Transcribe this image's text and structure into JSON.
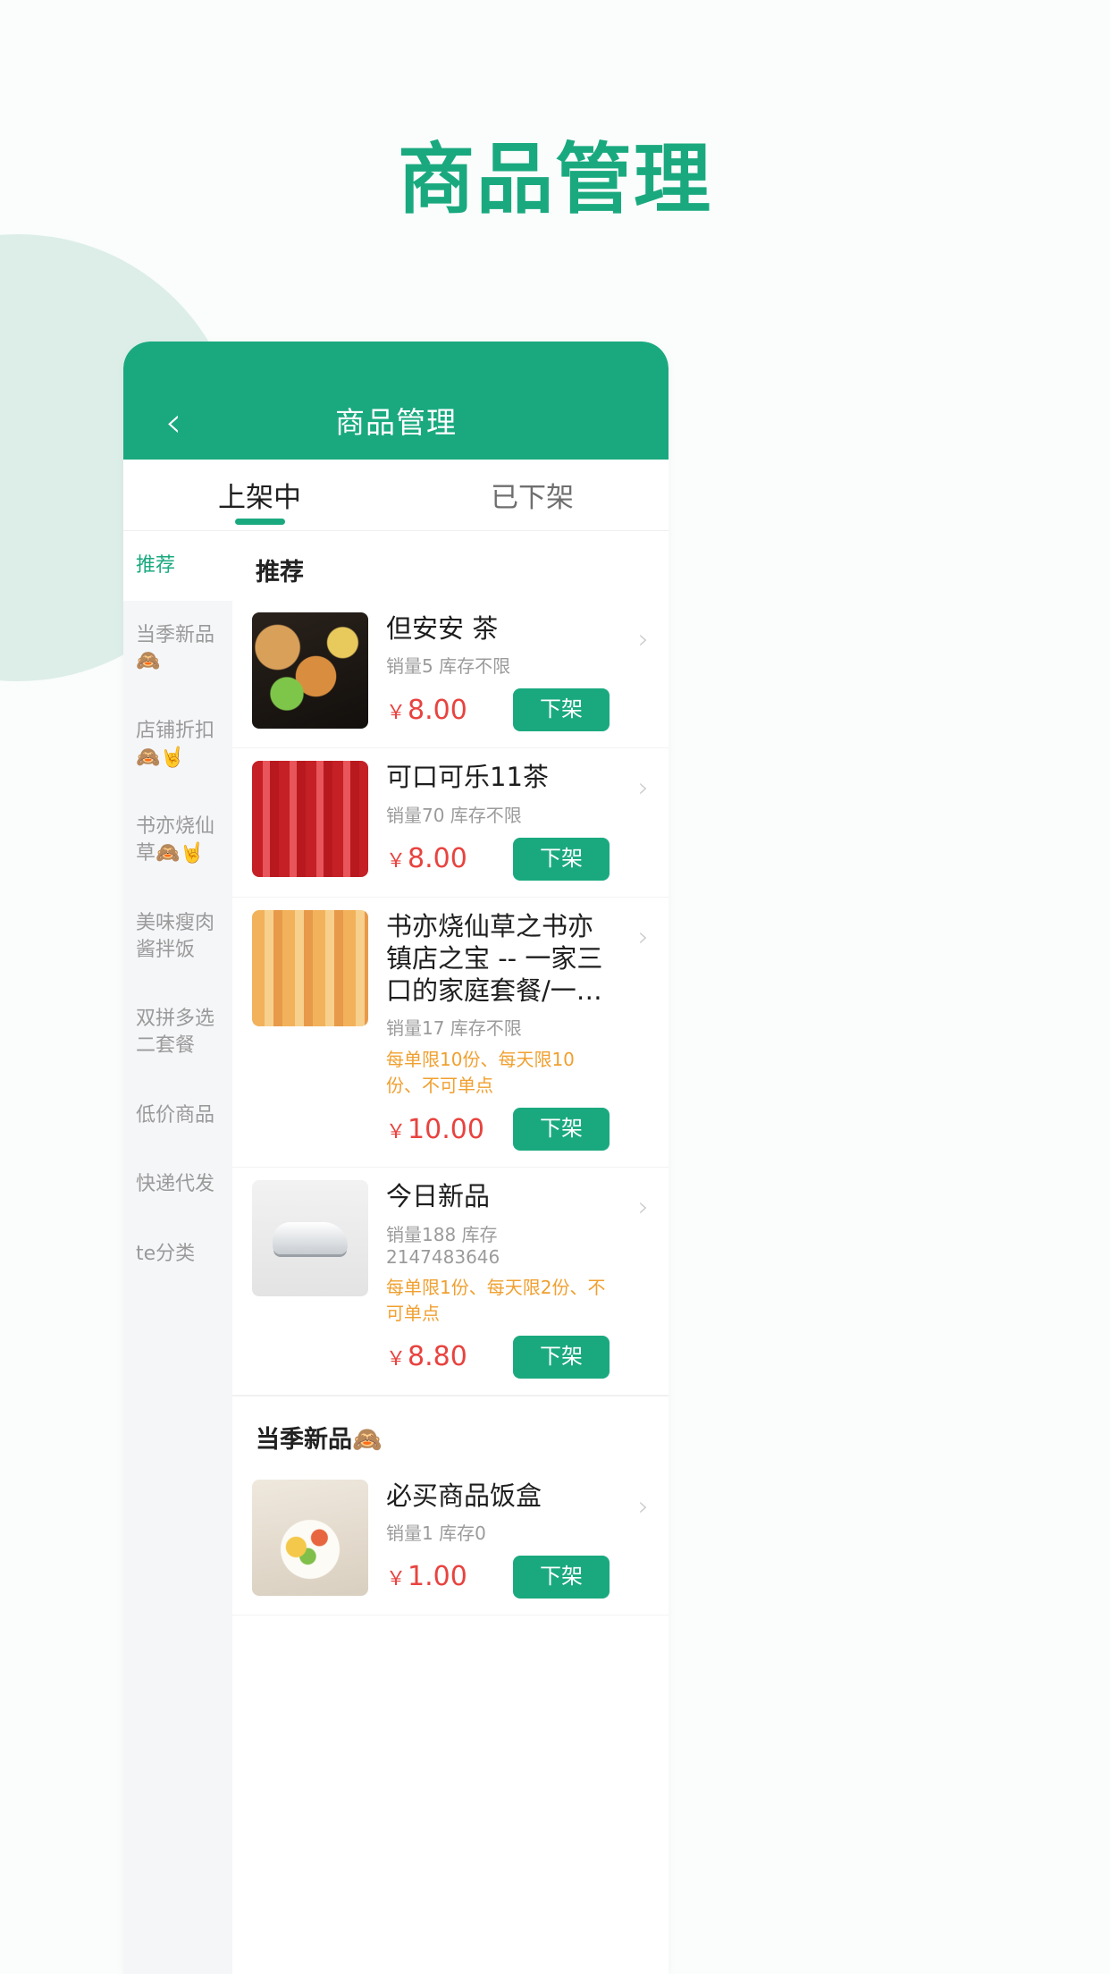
{
  "page": {
    "title": "商品管理",
    "accent_color": "#1aa97f",
    "background_color": "#fafdfb",
    "decor_circle_color": "#ddeee8"
  },
  "navbar": {
    "back_icon": "‹",
    "title": "商品管理"
  },
  "tabs": [
    {
      "label": "上架中",
      "active": true
    },
    {
      "label": "已下架",
      "active": false
    }
  ],
  "sidebar": {
    "items": [
      {
        "label": "推荐",
        "active": true
      },
      {
        "label": "当季新品🙈",
        "active": false
      },
      {
        "label": "店铺折扣🙈🤘",
        "active": false
      },
      {
        "label": "书亦烧仙草🙈🤘",
        "active": false
      },
      {
        "label": "美味瘦肉酱拌饭",
        "active": false
      },
      {
        "label": "双拼多选二套餐",
        "active": false
      },
      {
        "label": "低价商品",
        "active": false
      },
      {
        "label": "快递代发",
        "active": false
      },
      {
        "label": "te分类",
        "active": false
      }
    ]
  },
  "groups": [
    {
      "header": "推荐",
      "items": [
        {
          "title": "但安安 茶",
          "meta": "销量5 库存不限",
          "limit": "",
          "price_symbol": "￥",
          "price": "8.00",
          "action_label": "下架",
          "chevron": "›",
          "thumb_class": "t1"
        },
        {
          "title": "可口可乐11茶",
          "meta": "销量70 库存不限",
          "limit": "",
          "price_symbol": "￥",
          "price": "8.00",
          "action_label": "下架",
          "chevron": "›",
          "thumb_class": "t2"
        },
        {
          "title": "书亦烧仙草之书亦镇店之宝 -- 一家三口的家庭套餐/一…",
          "meta": "销量17 库存不限",
          "limit": "每单限10份、每天限10份、不可单点",
          "price_symbol": "￥",
          "price": "10.00",
          "action_label": "下架",
          "chevron": "›",
          "thumb_class": "t3"
        },
        {
          "title": "今日新品",
          "meta": "销量188 库存2147483646",
          "limit": "每单限1份、每天限2份、不可单点",
          "price_symbol": "￥",
          "price": "8.80",
          "action_label": "下架",
          "chevron": "›",
          "thumb_class": "t4"
        }
      ]
    },
    {
      "header": "当季新品🙈",
      "items": [
        {
          "title": "必买商品饭盒",
          "meta": "销量1 库存0",
          "limit": "",
          "price_symbol": "￥",
          "price": "1.00",
          "action_label": "下架",
          "chevron": "›",
          "thumb_class": "t5"
        }
      ]
    }
  ]
}
